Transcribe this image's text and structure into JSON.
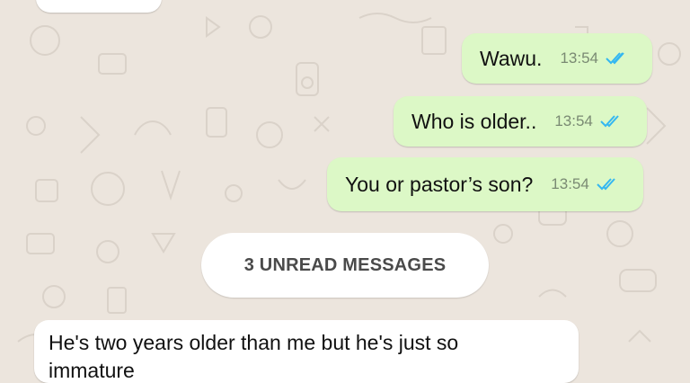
{
  "messages_outgoing": [
    {
      "text": "Wawu.",
      "time": "13:54",
      "status_icon": "double-check-read-icon"
    },
    {
      "text": "Who is older..",
      "time": "13:54",
      "status_icon": "double-check-read-icon"
    },
    {
      "text": "You or pastor’s son?",
      "time": "13:54",
      "status_icon": "double-check-read-icon"
    }
  ],
  "unread_banner": {
    "label": "3 UNREAD MESSAGES"
  },
  "message_incoming": {
    "text_line1": "He's two years older than me but he's just so",
    "text_line2": "immature"
  },
  "colors": {
    "outgoing_bubble": "#dcf8c6",
    "incoming_bubble": "#ffffff",
    "wallpaper": "#ece5dd",
    "read_ticks": "#34b7f1"
  }
}
